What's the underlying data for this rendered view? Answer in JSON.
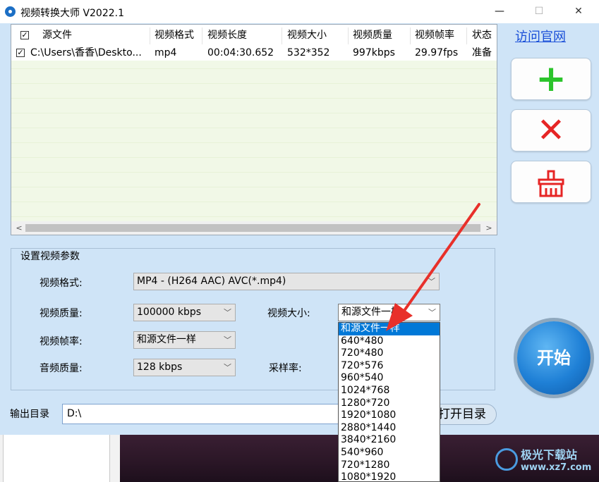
{
  "window": {
    "title": "视频转换大师 V2022.1",
    "minimize": "—",
    "maximize": "☐",
    "close": "✕"
  },
  "file_list": {
    "columns": [
      "源文件",
      "视频格式",
      "视频长度",
      "视频大小",
      "视频质量",
      "视频帧率",
      "状态"
    ],
    "rows": [
      {
        "checked": true,
        "source": "C:\\Users\\香香\\Deskto...",
        "format": "mp4",
        "length": "00:04:30.652",
        "size": "532*352",
        "quality": "997kbps",
        "fps": "29.97fps",
        "status": "准备"
      }
    ]
  },
  "sidebar": {
    "visit_site": "访问官网",
    "add_icon": "plus-icon",
    "delete_icon": "delete-icon",
    "clear_icon": "clear-icon",
    "start_label": "开始"
  },
  "params": {
    "group_title": "设置视频参数",
    "format_label": "视频格式:",
    "format_value": "MP4 - (H264 AAC) AVC(*.mp4)",
    "quality_label": "视频质量:",
    "quality_value": "100000 kbps",
    "size_label": "视频大小:",
    "size_value": "和源文件一样",
    "fps_label": "视频帧率:",
    "fps_value": "和源文件一样",
    "audio_label": "音频质量:",
    "audio_value": "128 kbps",
    "samplerate_label": "采样率:"
  },
  "size_dropdown": {
    "options": [
      "和源文件一样",
      "640*480",
      "720*480",
      "720*576",
      "960*540",
      "1024*768",
      "1280*720",
      "1920*1080",
      "2880*1440",
      "3840*2160",
      "540*960",
      "720*1280",
      "1080*1920"
    ],
    "selected_index": 0
  },
  "output": {
    "label": "输出目录",
    "path": "D:\\",
    "open_button": "打开目录"
  },
  "watermark": {
    "line1": "极光下载站",
    "line2": "www.xz7.com"
  },
  "colors": {
    "window_bg": "#cfe4f7",
    "selection": "#0078d7",
    "arrow": "#e8302a",
    "link": "#1a4fd8"
  }
}
